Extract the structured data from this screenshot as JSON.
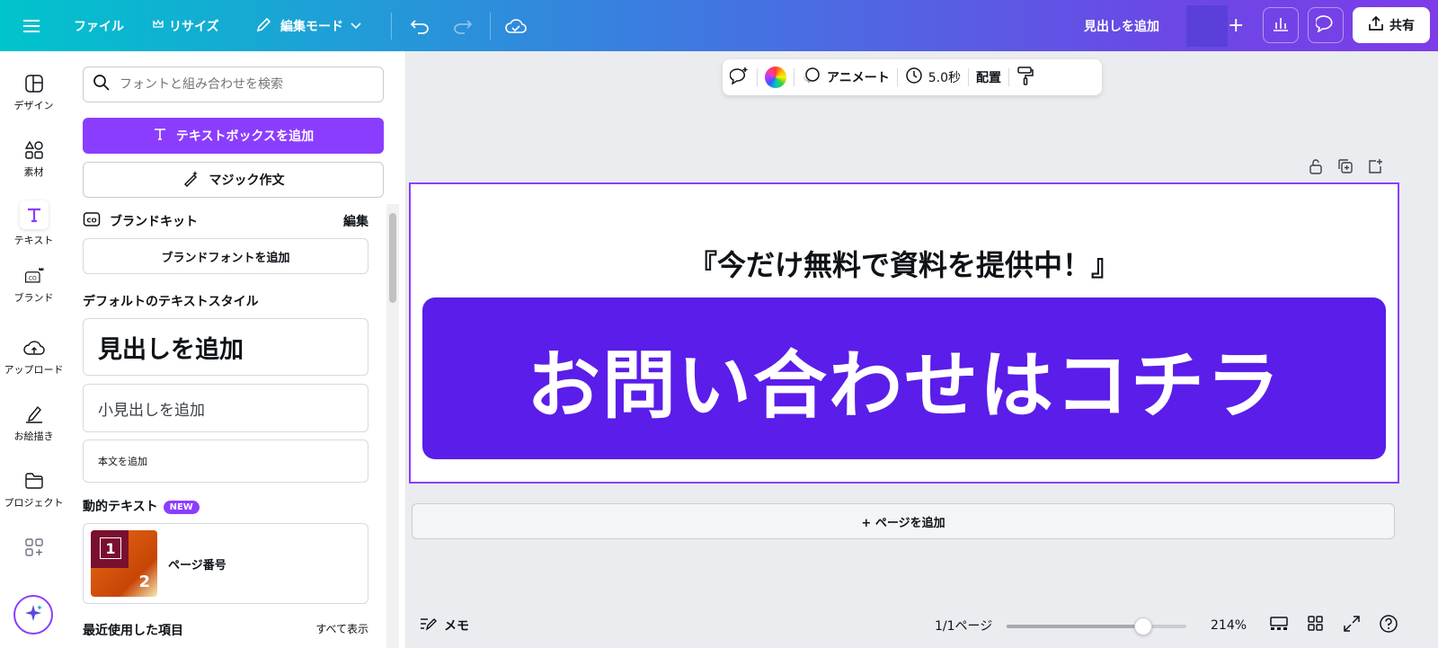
{
  "topbar": {
    "file_label": "ファイル",
    "resize_label": "リサイズ",
    "edit_mode_label": "編集モード",
    "add_heading_label": "見出しを追加",
    "share_label": "共有"
  },
  "rail": {
    "items": [
      {
        "label": "デザイン",
        "icon": "layout-icon"
      },
      {
        "label": "素材",
        "icon": "shapes-icon"
      },
      {
        "label": "テキスト",
        "icon": "text-icon"
      },
      {
        "label": "ブランド",
        "icon": "brand-icon"
      },
      {
        "label": "アップロード",
        "icon": "cloud-upload-icon"
      },
      {
        "label": "お絵描き",
        "icon": "draw-icon"
      },
      {
        "label": "プロジェクト",
        "icon": "folder-icon"
      }
    ]
  },
  "panel": {
    "search_placeholder": "フォントと組み合わせを検索",
    "add_textbox_label": "テキストボックスを追加",
    "magic_write_label": "マジック作文",
    "brand_kit_label": "ブランドキット",
    "brand_kit_edit": "編集",
    "add_brand_font_label": "ブランドフォントを追加",
    "default_styles_title": "デフォルトのテキストスタイル",
    "add_heading": "見出しを追加",
    "add_subheading": "小見出しを追加",
    "add_body": "本文を追加",
    "dynamic_text_title": "動的テキスト",
    "new_badge": "NEW",
    "page_number_label": "ページ番号",
    "page_number_thumb_1": "1",
    "page_number_thumb_2": "2",
    "recent_title": "最近使用した項目",
    "show_all": "すべて表示"
  },
  "context_toolbar": {
    "animate_label": "アニメート",
    "duration_label": "5.0秒",
    "position_label": "配置"
  },
  "canvas": {
    "headline": "『今だけ無料で資料を提供中！』",
    "cta_text": "お問い合わせはコチラ",
    "cta_color": "#5b1de9",
    "add_page_label": "+ ページを追加"
  },
  "bottombar": {
    "notes_label": "メモ",
    "page_indicator": "1/1ページ",
    "zoom_label": "214%",
    "zoom_slider_fraction": 0.76
  },
  "colors": {
    "accent": "#8b3dff",
    "gradient_start": "#00c4cc",
    "gradient_end": "#7d3ce8"
  }
}
